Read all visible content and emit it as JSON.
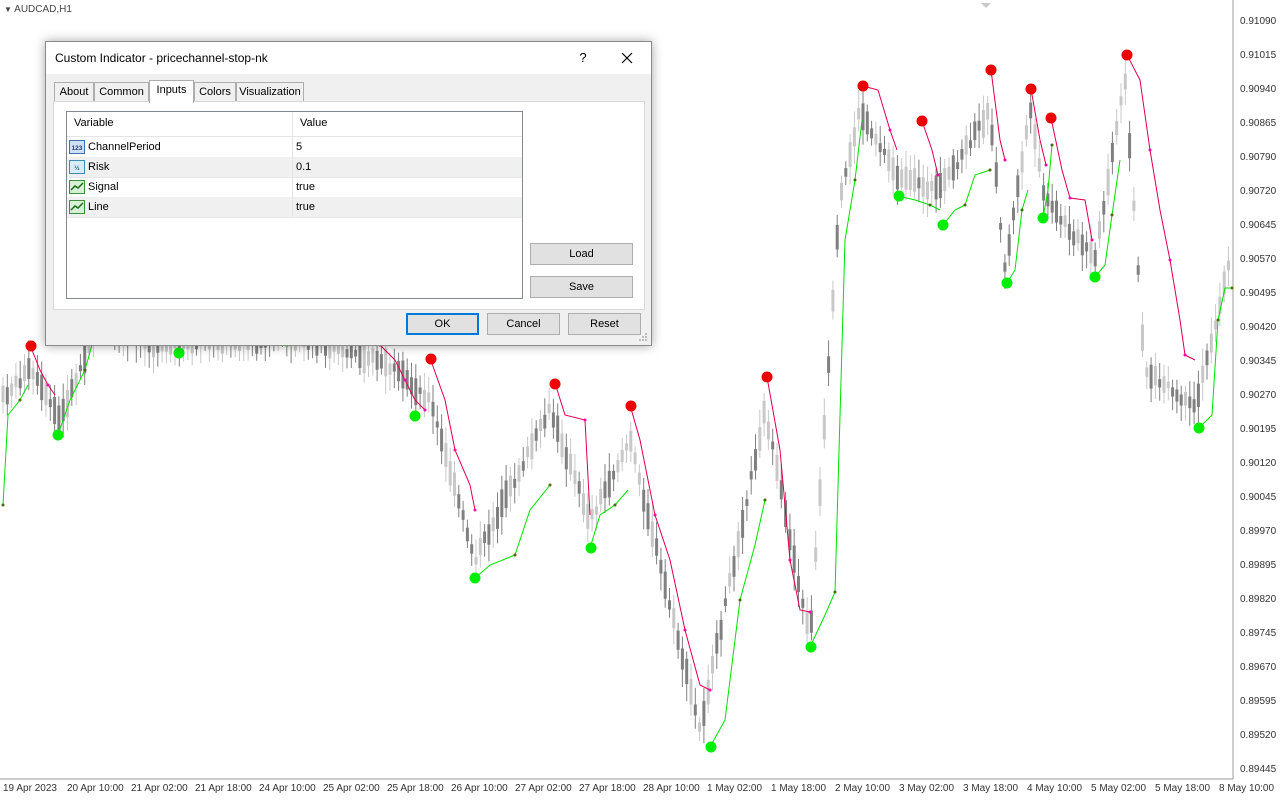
{
  "chart": {
    "symbol": "AUDCAD,H1",
    "price_labels": [
      "0.91090",
      "0.91015",
      "0.90940",
      "0.90865",
      "0.90790",
      "0.90720",
      "0.90645",
      "0.90570",
      "0.90495",
      "0.90420",
      "0.90345",
      "0.90270",
      "0.90195",
      "0.90120",
      "0.90045",
      "0.89970",
      "0.89895",
      "0.89820",
      "0.89745",
      "0.89670",
      "0.89595",
      "0.89520",
      "0.89445"
    ],
    "time_labels": [
      "19 Apr 2023",
      "20 Apr 10:00",
      "21 Apr 02:00",
      "21 Apr 18:00",
      "24 Apr 10:00",
      "25 Apr 02:00",
      "25 Apr 18:00",
      "26 Apr 10:00",
      "27 Apr 02:00",
      "27 Apr 18:00",
      "28 Apr 10:00",
      "1 May 02:00",
      "1 May 18:00",
      "2 May 10:00",
      "3 May 02:00",
      "3 May 18:00",
      "4 May 10:00",
      "5 May 02:00",
      "5 May 18:00",
      "8 May 10:00"
    ],
    "colors": {
      "bull_candle": "#c8c8c8",
      "bear_candle": "#808080",
      "up_line": "#00e000",
      "down_line": "#e0004a",
      "buy_signal": "#00ee00",
      "sell_signal": "#ee0000"
    }
  },
  "dialog": {
    "title": "Custom Indicator - pricechannel-stop-nk",
    "help_label": "?",
    "close_icon": "close-icon",
    "tabs": [
      {
        "label": "About",
        "active": false
      },
      {
        "label": "Common",
        "active": false
      },
      {
        "label": "Inputs",
        "active": true
      },
      {
        "label": "Colors",
        "active": false
      },
      {
        "label": "Visualization",
        "active": false
      }
    ],
    "table": {
      "headers": {
        "variable": "Variable",
        "value": "Value"
      },
      "rows": [
        {
          "icon": "integer-icon",
          "name": "ChannelPeriod",
          "value": "5"
        },
        {
          "icon": "double-icon",
          "name": "Risk",
          "value": "0.1"
        },
        {
          "icon": "bool-icon",
          "name": "Signal",
          "value": "true"
        },
        {
          "icon": "bool-icon",
          "name": "Line",
          "value": "true"
        }
      ]
    },
    "buttons": {
      "load": "Load",
      "save": "Save",
      "ok": "OK",
      "cancel": "Cancel",
      "reset": "Reset"
    }
  }
}
